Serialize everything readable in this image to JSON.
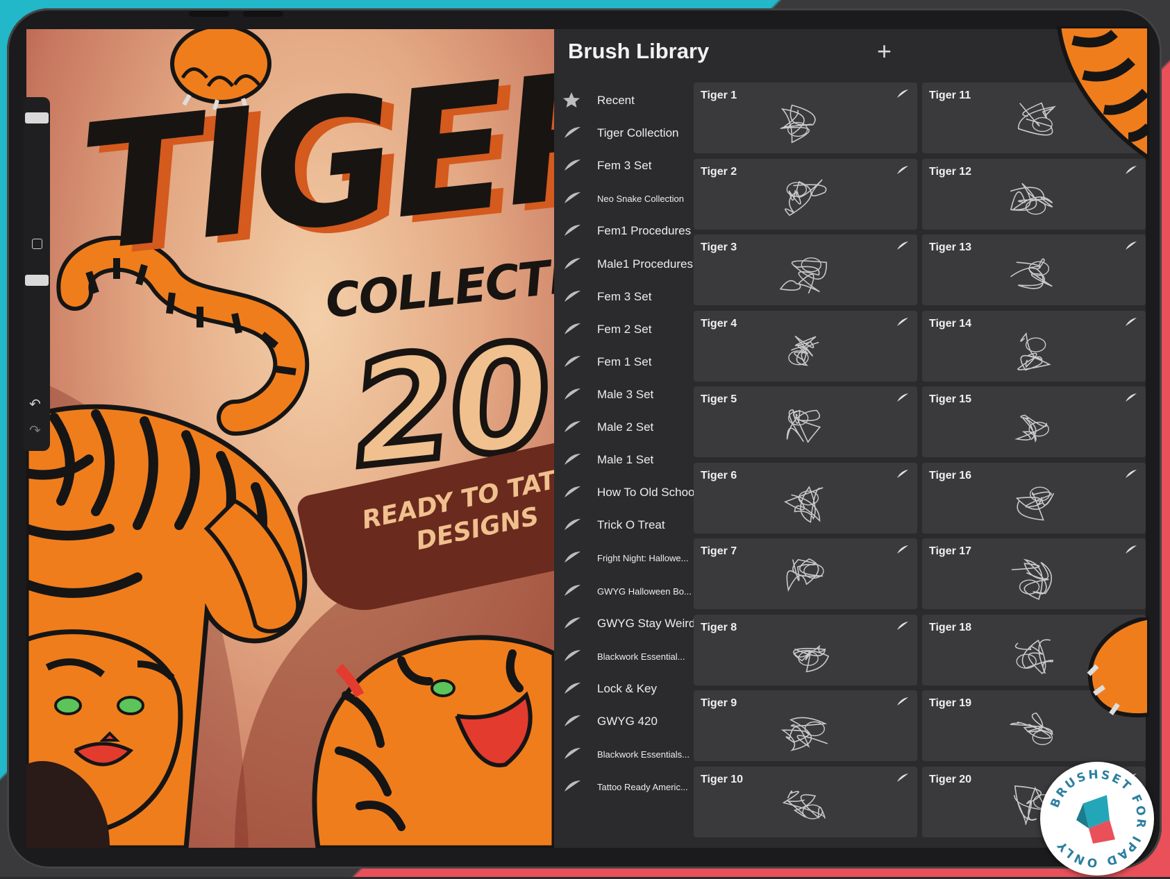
{
  "poster": {
    "title": "TIGER",
    "subtitle": "COLLECTION",
    "count": "20",
    "tagline_1": "READY TO TATTOO",
    "tagline_2": "DESIGNS"
  },
  "library": {
    "title": "Brush Library",
    "add_icon": "plus-icon",
    "sets": [
      {
        "label": "Recent",
        "icon": "star-icon"
      },
      {
        "label": "Tiger Collection",
        "icon": "brush-stroke-icon"
      },
      {
        "label": "Fem 3 Set",
        "icon": "brush-stroke-icon"
      },
      {
        "label": "Neo Snake Collection",
        "icon": "brush-stroke-icon"
      },
      {
        "label": "Fem1 Procedures",
        "icon": "brush-stroke-icon"
      },
      {
        "label": "Male1 Procedures",
        "icon": "brush-stroke-icon"
      },
      {
        "label": "Fem 3 Set",
        "icon": "brush-stroke-icon"
      },
      {
        "label": "Fem 2 Set",
        "icon": "brush-stroke-icon"
      },
      {
        "label": "Fem 1 Set",
        "icon": "brush-stroke-icon"
      },
      {
        "label": "Male 3 Set",
        "icon": "brush-stroke-icon"
      },
      {
        "label": "Male 2 Set",
        "icon": "brush-stroke-icon"
      },
      {
        "label": "Male 1 Set",
        "icon": "brush-stroke-icon"
      },
      {
        "label": "How To Old School",
        "icon": "brush-stroke-icon"
      },
      {
        "label": "Trick O Treat",
        "icon": "brush-stroke-icon"
      },
      {
        "label": "Fright Night: Hallowe...",
        "icon": "brush-stroke-icon"
      },
      {
        "label": "GWYG Halloween Bo...",
        "icon": "brush-stroke-icon"
      },
      {
        "label": "GWYG Stay Weird",
        "icon": "brush-stroke-icon"
      },
      {
        "label": "Blackwork Essential...",
        "icon": "brush-stroke-icon"
      },
      {
        "label": "Lock & Key",
        "icon": "brush-stroke-icon"
      },
      {
        "label": "GWYG 420",
        "icon": "brush-stroke-icon"
      },
      {
        "label": "Blackwork Essentials...",
        "icon": "brush-stroke-icon"
      },
      {
        "label": "Tattoo Ready Americ...",
        "icon": "brush-stroke-icon"
      }
    ],
    "brushes_col1": [
      "Tiger 1",
      "Tiger 2",
      "Tiger 3",
      "Tiger 4",
      "Tiger 5",
      "Tiger 6",
      "Tiger 7",
      "Tiger 8",
      "Tiger 9",
      "Tiger 10"
    ],
    "brushes_col2": [
      "Tiger 11",
      "Tiger 12",
      "Tiger 13",
      "Tiger 14",
      "Tiger 15",
      "Tiger 16",
      "Tiger 17",
      "Tiger 18",
      "Tiger 19",
      "Tiger 20"
    ]
  },
  "badge": {
    "text": "BRUSHSET FOR IPAD ONLY"
  },
  "colors": {
    "teal": "#22b7c9",
    "coral": "#e9505a",
    "panel": "#2b2b2d",
    "tile": "#3a3a3c",
    "tiger_orange": "#f07d1c"
  }
}
